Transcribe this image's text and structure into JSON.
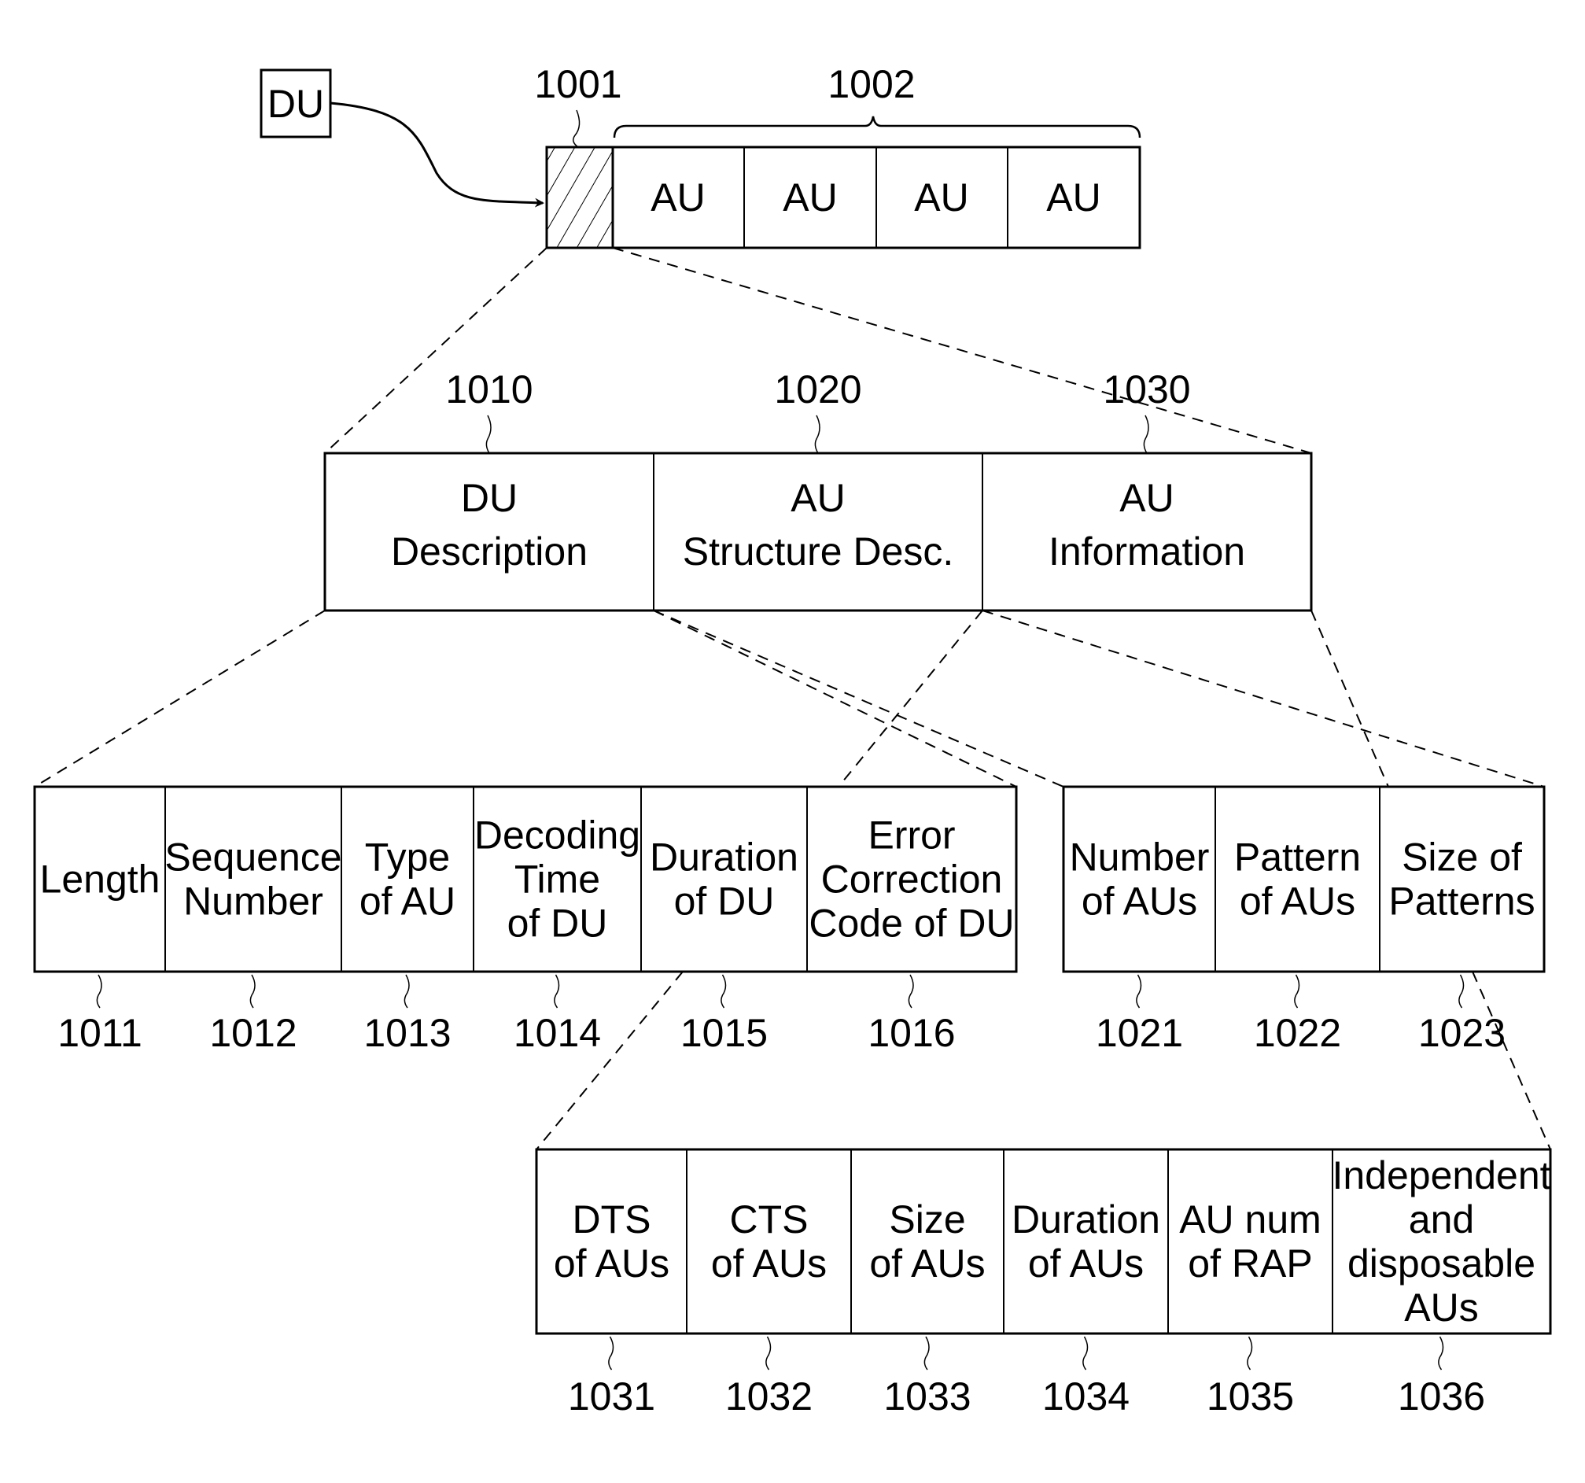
{
  "du_source": {
    "label": "DU"
  },
  "top_bar": {
    "header_ref": "1001",
    "au_group_ref": "1002",
    "au_cells": [
      "AU",
      "AU",
      "AU",
      "AU"
    ]
  },
  "level1": {
    "cells": [
      {
        "lines": [
          "DU",
          "Description"
        ],
        "ref": "1010"
      },
      {
        "lines": [
          "AU",
          "Structure Desc."
        ],
        "ref": "1020"
      },
      {
        "lines": [
          "AU",
          "Information"
        ],
        "ref": "1030"
      }
    ]
  },
  "du_description_fields": [
    {
      "lines": [
        "Length"
      ],
      "ref": "1011"
    },
    {
      "lines": [
        "Sequence",
        "Number"
      ],
      "ref": "1012"
    },
    {
      "lines": [
        "Type",
        "of AU"
      ],
      "ref": "1013"
    },
    {
      "lines": [
        "Decoding",
        "Time",
        "of DU"
      ],
      "ref": "1014"
    },
    {
      "lines": [
        "Duration",
        "of DU"
      ],
      "ref": "1015"
    },
    {
      "lines": [
        "Error",
        "Correction",
        "Code of DU"
      ],
      "ref": "1016"
    }
  ],
  "au_structure_fields": [
    {
      "lines": [
        "Number",
        "of AUs"
      ],
      "ref": "1021"
    },
    {
      "lines": [
        "Pattern",
        "of AUs"
      ],
      "ref": "1022"
    },
    {
      "lines": [
        "Size of",
        "Patterns"
      ],
      "ref": "1023"
    }
  ],
  "au_information_fields": [
    {
      "lines": [
        "DTS",
        "of AUs"
      ],
      "ref": "1031"
    },
    {
      "lines": [
        "CTS",
        "of AUs"
      ],
      "ref": "1032"
    },
    {
      "lines": [
        "Size",
        "of AUs"
      ],
      "ref": "1033"
    },
    {
      "lines": [
        "Duration",
        "of AUs"
      ],
      "ref": "1034"
    },
    {
      "lines": [
        "AU num",
        "of RAP"
      ],
      "ref": "1035"
    },
    {
      "lines": [
        "Independent",
        "and",
        "disposable",
        "AUs"
      ],
      "ref": "1036"
    }
  ]
}
